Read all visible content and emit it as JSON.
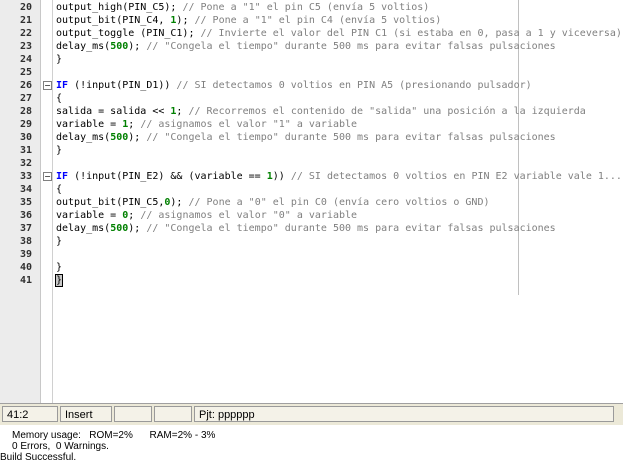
{
  "editor": {
    "lines": [
      {
        "n": "20",
        "fold": false,
        "tokens": [
          [
            "plain",
            "output_high(PIN_C5); "
          ],
          [
            "cmt",
            "// Pone a \"1\" el pin C5 (envía 5 voltios)"
          ]
        ]
      },
      {
        "n": "21",
        "fold": false,
        "tokens": [
          [
            "plain",
            "output_bit(PIN_C4, "
          ],
          [
            "num",
            "1"
          ],
          [
            "plain",
            "); "
          ],
          [
            "cmt",
            "// Pone a \"1\" el pin C4 (envía 5 voltios)"
          ]
        ]
      },
      {
        "n": "22",
        "fold": false,
        "tokens": [
          [
            "plain",
            "output_toggle (PIN_C1); "
          ],
          [
            "cmt",
            "// Invierte el valor del PIN C1 (si estaba en 0, pasa a 1 y viceversa)"
          ]
        ]
      },
      {
        "n": "23",
        "fold": false,
        "tokens": [
          [
            "plain",
            "delay_ms("
          ],
          [
            "num",
            "500"
          ],
          [
            "plain",
            "); "
          ],
          [
            "cmt",
            "// \"Congela el tiempo\" durante 500 ms para evitar falsas pulsaciones"
          ]
        ]
      },
      {
        "n": "24",
        "fold": false,
        "tokens": [
          [
            "plain",
            "}"
          ]
        ]
      },
      {
        "n": "25",
        "fold": false,
        "tokens": []
      },
      {
        "n": "26",
        "fold": true,
        "tokens": [
          [
            "kw",
            "IF"
          ],
          [
            "plain",
            " (!input(PIN_D1)) "
          ],
          [
            "cmt",
            "// SI detectamos 0 voltios en PIN A5 (presionando pulsador)"
          ]
        ]
      },
      {
        "n": "27",
        "fold": false,
        "tokens": [
          [
            "plain",
            "{"
          ]
        ]
      },
      {
        "n": "28",
        "fold": false,
        "tokens": [
          [
            "plain",
            "salida = salida << "
          ],
          [
            "num",
            "1"
          ],
          [
            "plain",
            "; "
          ],
          [
            "cmt",
            "// Recorremos el contenido de \"salida\" una posición a la izquierda"
          ]
        ]
      },
      {
        "n": "29",
        "fold": false,
        "tokens": [
          [
            "plain",
            "variable = "
          ],
          [
            "num",
            "1"
          ],
          [
            "plain",
            "; "
          ],
          [
            "cmt",
            "// asignamos el valor \"1\" a variable"
          ]
        ]
      },
      {
        "n": "30",
        "fold": false,
        "tokens": [
          [
            "plain",
            "delay_ms("
          ],
          [
            "num",
            "500"
          ],
          [
            "plain",
            "); "
          ],
          [
            "cmt",
            "// \"Congela el tiempo\" durante 500 ms para evitar falsas pulsaciones"
          ]
        ]
      },
      {
        "n": "31",
        "fold": false,
        "tokens": [
          [
            "plain",
            "}"
          ]
        ]
      },
      {
        "n": "32",
        "fold": false,
        "tokens": []
      },
      {
        "n": "33",
        "fold": true,
        "tokens": [
          [
            "kw",
            "IF"
          ],
          [
            "plain",
            " (!input(PIN_E2) && (variable == "
          ],
          [
            "num",
            "1"
          ],
          [
            "plain",
            ")) "
          ],
          [
            "cmt",
            "// SI detectamos 0 voltios en PIN E2 variable vale 1...."
          ]
        ]
      },
      {
        "n": "34",
        "fold": false,
        "tokens": [
          [
            "plain",
            "{"
          ]
        ]
      },
      {
        "n": "35",
        "fold": false,
        "tokens": [
          [
            "plain",
            "output_bit(PIN_C5,"
          ],
          [
            "num",
            "0"
          ],
          [
            "plain",
            "); "
          ],
          [
            "cmt",
            "// Pone a \"0\" el pin C0 (envía cero voltios o GND)"
          ]
        ]
      },
      {
        "n": "36",
        "fold": false,
        "tokens": [
          [
            "plain",
            "variable = "
          ],
          [
            "num",
            "0"
          ],
          [
            "plain",
            "; "
          ],
          [
            "cmt",
            "// asignamos el valor \"0\" a variable"
          ]
        ]
      },
      {
        "n": "37",
        "fold": false,
        "tokens": [
          [
            "plain",
            "delay_ms("
          ],
          [
            "num",
            "500"
          ],
          [
            "plain",
            "); "
          ],
          [
            "cmt",
            "// \"Congela el tiempo\" durante 500 ms para evitar falsas pulsaciones"
          ]
        ]
      },
      {
        "n": "38",
        "fold": false,
        "tokens": [
          [
            "plain",
            "}"
          ]
        ]
      },
      {
        "n": "39",
        "fold": false,
        "tokens": []
      },
      {
        "n": "40",
        "fold": false,
        "tokens": [
          [
            "plain",
            "}"
          ]
        ]
      },
      {
        "n": "41",
        "fold": false,
        "tokens": [
          [
            "brace-hl",
            "}"
          ]
        ]
      }
    ]
  },
  "statusbar": {
    "position": "41:2",
    "mode": "Insert",
    "project": "Pjt: pppppp"
  },
  "output": {
    "memory": "Memory usage:   ROM=2%      RAM=2% - 3%",
    "errors": "0 Errors,  0 Warnings.",
    "build": "Build Successful."
  }
}
